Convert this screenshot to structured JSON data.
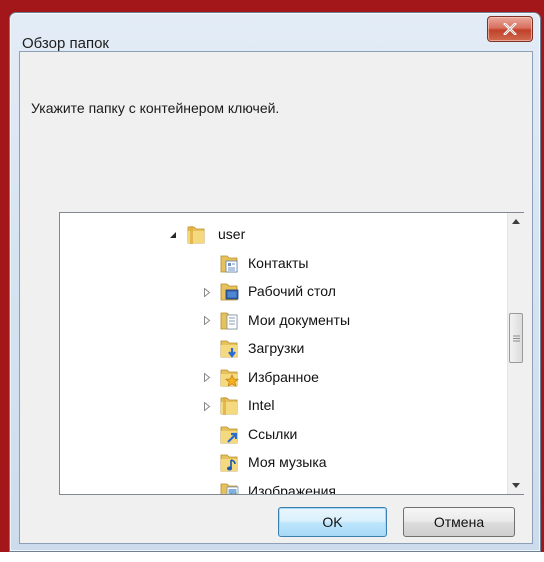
{
  "dialog": {
    "title": "Обзор папок",
    "prompt": "Укажите папку с контейнером ключей.",
    "ok_label": "OK",
    "cancel_label": "Отмена"
  },
  "tree": {
    "root": {
      "label": "user",
      "icon": "folder-icon",
      "expanded": true
    },
    "items": [
      {
        "label": "Контакты",
        "icon": "contacts-folder-icon",
        "has_children": false
      },
      {
        "label": "Рабочий стол",
        "icon": "desktop-folder-icon",
        "has_children": true
      },
      {
        "label": "Мои документы",
        "icon": "documents-folder-icon",
        "has_children": true
      },
      {
        "label": "Загрузки",
        "icon": "downloads-folder-icon",
        "has_children": false
      },
      {
        "label": "Избранное",
        "icon": "favorites-folder-icon",
        "has_children": true
      },
      {
        "label": "Intel",
        "icon": "folder-icon",
        "has_children": true
      },
      {
        "label": "Ссылки",
        "icon": "links-folder-icon",
        "has_children": false
      },
      {
        "label": "Моя музыка",
        "icon": "music-folder-icon",
        "has_children": false
      },
      {
        "label": "Изображения",
        "icon": "pictures-folder-icon",
        "has_children": false
      }
    ]
  },
  "colors": {
    "background_frame": "#a3171b",
    "close_button": "#c1412b",
    "default_button_border": "#3c7fb1"
  }
}
